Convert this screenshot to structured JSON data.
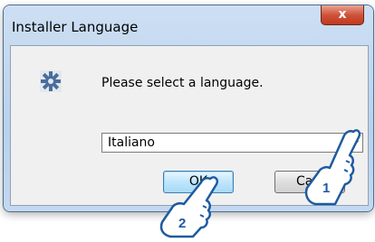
{
  "window": {
    "title": "Installer Language",
    "close_glyph": "x"
  },
  "dialog": {
    "prompt": "Please select a language.",
    "icon": "installer-gear-icon"
  },
  "language_select": {
    "selected": "Italiano"
  },
  "buttons": {
    "ok": "OK",
    "cancel": "Ca"
  },
  "callouts": [
    {
      "number": "1"
    },
    {
      "number": "2"
    }
  ],
  "colors": {
    "ok_highlight": "#bee6fd",
    "close_red": "#d0523a",
    "callout_blue": "#1e5aa0"
  }
}
